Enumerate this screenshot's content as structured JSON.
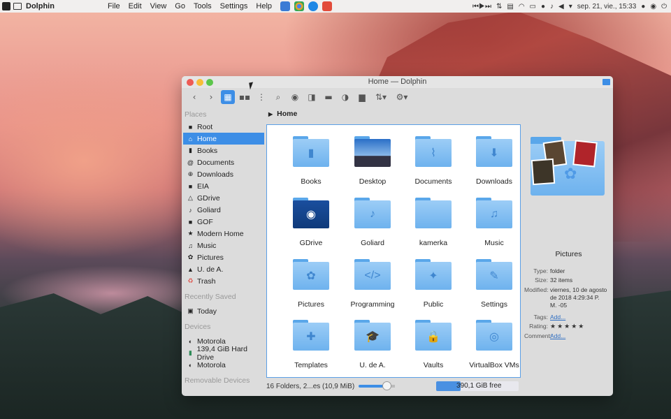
{
  "panel": {
    "app_name": "Dolphin",
    "menu": [
      "File",
      "Edit",
      "View",
      "Go",
      "Tools",
      "Settings",
      "Help"
    ],
    "clock": "sep. 21, vie., 15:33",
    "launchers": [
      {
        "name": "files-launcher-icon",
        "color": "#3a7bd5"
      },
      {
        "name": "chrome-launcher-icon",
        "color": "#e0a030"
      },
      {
        "name": "edge-launcher-icon",
        "color": "#1e88e5"
      },
      {
        "name": "video-launcher-icon",
        "color": "#e24b3a"
      }
    ]
  },
  "window": {
    "title": "Home — Dolphin",
    "breadcrumb": "Home"
  },
  "sidebar": {
    "places_label": "Places",
    "places": [
      {
        "label": "Root",
        "icon": "folder-icon"
      },
      {
        "label": "Home",
        "icon": "home-icon",
        "selected": true
      },
      {
        "label": "Books",
        "icon": "book-icon"
      },
      {
        "label": "Documents",
        "icon": "paperclip-icon"
      },
      {
        "label": "Downloads",
        "icon": "download-icon"
      },
      {
        "label": "EIA",
        "icon": "folder-icon"
      },
      {
        "label": "GDrive",
        "icon": "drive-icon"
      },
      {
        "label": "Goliard",
        "icon": "guitar-icon"
      },
      {
        "label": "GOF",
        "icon": "folder-icon"
      },
      {
        "label": "Modern Home",
        "icon": "star-icon"
      },
      {
        "label": "Music",
        "icon": "music-icon"
      },
      {
        "label": "Pictures",
        "icon": "flower-icon"
      },
      {
        "label": "U. de A.",
        "icon": "graduation-icon"
      },
      {
        "label": "Trash",
        "icon": "trash-icon"
      }
    ],
    "recent_label": "Recently Saved",
    "recent": [
      {
        "label": "Today",
        "icon": "calendar-icon"
      }
    ],
    "devices_label": "Devices",
    "devices": [
      {
        "label": "Motorola",
        "icon": "phone-icon"
      },
      {
        "label": "139,4 GiB Hard Drive",
        "icon": "drive-icon"
      },
      {
        "label": "Motorola",
        "icon": "phone-icon"
      }
    ],
    "removable_label": "Removable Devices"
  },
  "files": [
    {
      "label": "Books",
      "glyph": "▮"
    },
    {
      "label": "Desktop",
      "glyph": ""
    },
    {
      "label": "Documents",
      "glyph": "⌇"
    },
    {
      "label": "Downloads",
      "glyph": "⬇"
    },
    {
      "label": "GDrive",
      "glyph": "◉"
    },
    {
      "label": "Goliard",
      "glyph": "♪"
    },
    {
      "label": "kamerka",
      "glyph": ""
    },
    {
      "label": "Music",
      "glyph": "♫"
    },
    {
      "label": "Pictures",
      "glyph": "✿"
    },
    {
      "label": "Programming",
      "glyph": "</>"
    },
    {
      "label": "Public",
      "glyph": "✦"
    },
    {
      "label": "Settings",
      "glyph": "✎"
    },
    {
      "label": "Templates",
      "glyph": "✚"
    },
    {
      "label": "U. de A.",
      "glyph": "🎓"
    },
    {
      "label": "Vaults",
      "glyph": "🔒"
    },
    {
      "label": "VirtualBox VMs",
      "glyph": "◎"
    }
  ],
  "info": {
    "title": "Pictures",
    "type_k": "Type:",
    "type_v": "folder",
    "size_k": "Size:",
    "size_v": "32 items",
    "modified_k": "Modified:",
    "modified_v": "viernes, 10 de agosto de 2018 4:29:34 P. M. -05",
    "tags_k": "Tags:",
    "tags_v": "Add...",
    "rating_k": "Rating:",
    "rating_v": "★★★★★",
    "comment_k": "Comment:",
    "comment_v": "Add..."
  },
  "status": {
    "summary": "16 Folders, 2...es (10,9 MiB)",
    "zoom_fraction": 0.8,
    "free_space": "390,1 GiB free",
    "free_fraction": 0.3
  }
}
